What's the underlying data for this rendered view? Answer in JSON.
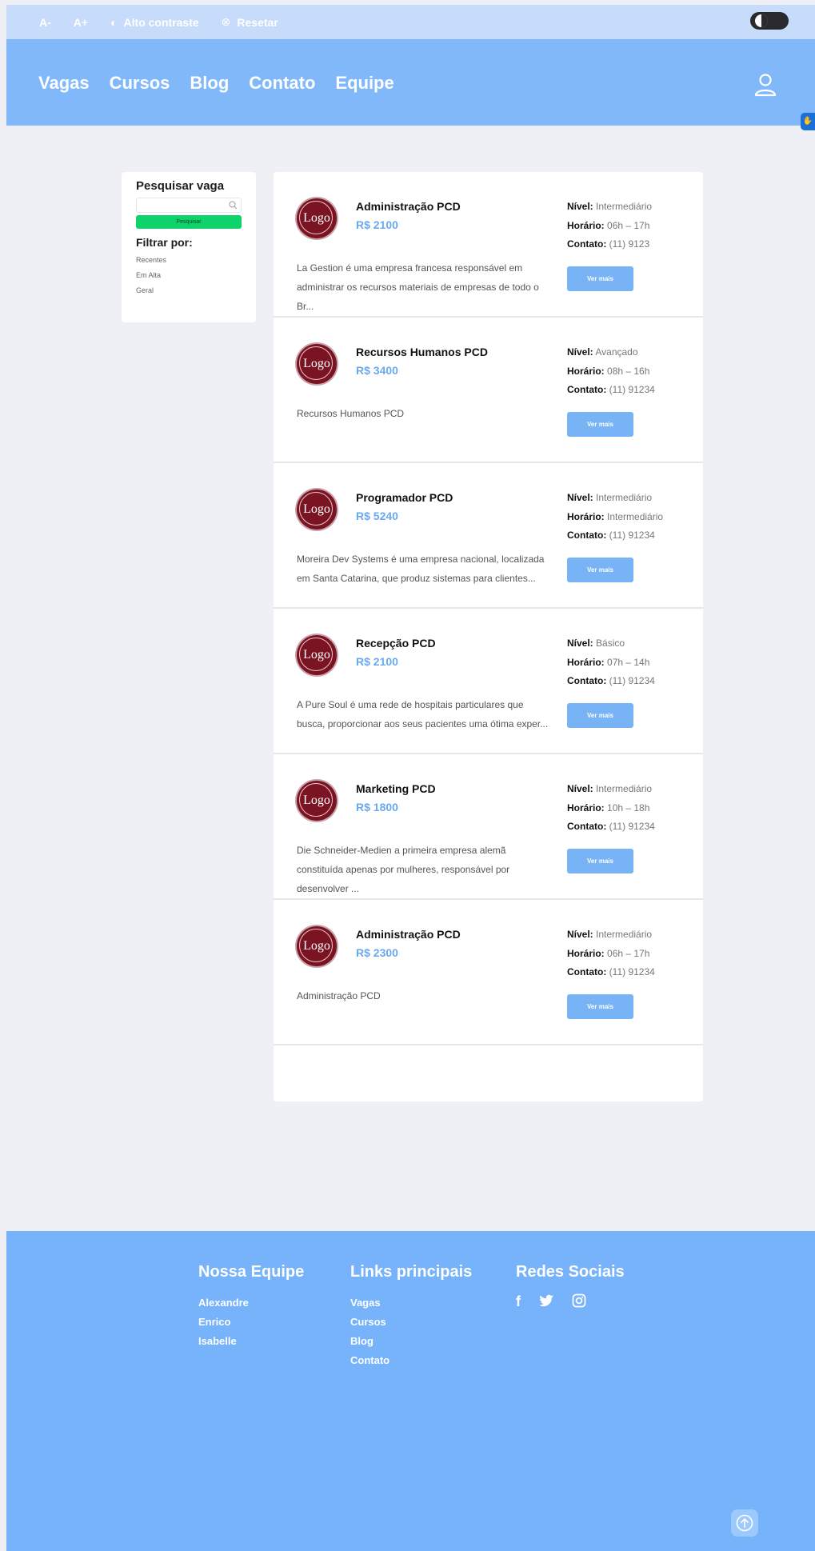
{
  "a11y": {
    "font_decrease": "A-",
    "font_increase": "A+",
    "contrast": "Alto contraste",
    "reset": "Resetar"
  },
  "nav": {
    "links": [
      "Vagas",
      "Cursos",
      "Blog",
      "Contato",
      "Equipe"
    ]
  },
  "filter": {
    "title": "Pesquisar vaga",
    "search_placeholder": "",
    "search_button": "Pesquisar",
    "filter_title": "Filtrar por:",
    "options": [
      "Recentes",
      "Em Alta",
      "Geral"
    ]
  },
  "jobs": [
    {
      "logo": "Logo",
      "title": "Administração PCD",
      "salary": "R$ 2100",
      "description": "La Gestion é uma empresa francesa responsável em administrar os recursos materiais de empresas de todo o Br...",
      "nivel_label": "Nível:",
      "nivel": "Intermediário",
      "horario_label": "Horário:",
      "horario": "06h – 17h",
      "contato_label": "Contato:",
      "contato": "(11) 9123",
      "button": "Ver mais"
    },
    {
      "logo": "Logo",
      "title": "Recursos Humanos PCD",
      "salary": "R$ 3400",
      "description": "Recursos Humanos PCD",
      "nivel_label": "Nível:",
      "nivel": "Avançado",
      "horario_label": "Horário:",
      "horario": "08h – 16h",
      "contato_label": "Contato:",
      "contato": "(11) 91234",
      "button": "Ver mais"
    },
    {
      "logo": "Logo",
      "title": "Programador PCD",
      "salary": "R$ 5240",
      "description": "Moreira Dev Systems é uma empresa nacional, localizada em Santa Catarina, que produz sistemas para clientes...",
      "nivel_label": "Nível:",
      "nivel": "Intermediário",
      "horario_label": "Horário:",
      "horario": "Intermediário",
      "contato_label": "Contato:",
      "contato": "(11) 91234",
      "button": "Ver mais"
    },
    {
      "logo": "Logo",
      "title": "Recepção PCD",
      "salary": "R$ 2100",
      "description": "A Pure Soul é uma rede de hospitais particulares que busca, proporcionar aos seus pacientes uma ótima exper...",
      "nivel_label": "Nível:",
      "nivel": "Básico",
      "horario_label": "Horário:",
      "horario": "07h – 14h",
      "contato_label": "Contato:",
      "contato": "(11) 91234",
      "button": "Ver mais"
    },
    {
      "logo": "Logo",
      "title": "Marketing PCD",
      "salary": "R$ 1800",
      "description": "Die Schneider-Medien a primeira empresa alemã constituída apenas por mulheres, responsável por desenvolver ...",
      "nivel_label": "Nível:",
      "nivel": "Intermediário",
      "horario_label": "Horário:",
      "horario": "10h – 18h",
      "contato_label": "Contato:",
      "contato": "(11) 91234",
      "button": "Ver mais"
    },
    {
      "logo": "Logo",
      "title": "Administração PCD",
      "salary": "R$ 2300",
      "description": "Administração PCD",
      "nivel_label": "Nível:",
      "nivel": "Intermediário",
      "horario_label": "Horário:",
      "horario": "06h – 17h",
      "contato_label": "Contato:",
      "contato": "(11) 91234",
      "button": "Ver mais"
    }
  ],
  "footer": {
    "team_title": "Nossa Equipe",
    "team": [
      "Alexandre",
      "Enrico",
      "Isabelle"
    ],
    "links_title": "Links principais",
    "links": [
      "Vagas",
      "Cursos",
      "Blog",
      "Contato"
    ],
    "social_title": "Redes Sociais",
    "social_icons": [
      "facebook-icon",
      "twitter-icon",
      "instagram-icon"
    ]
  },
  "colors": {
    "header": "#80b8f9",
    "topbar": "#c7dcfa",
    "footer": "#77b3fa",
    "accent": "#6aa9f1",
    "search_button": "#0dd36a",
    "logo": "#7a1422"
  }
}
